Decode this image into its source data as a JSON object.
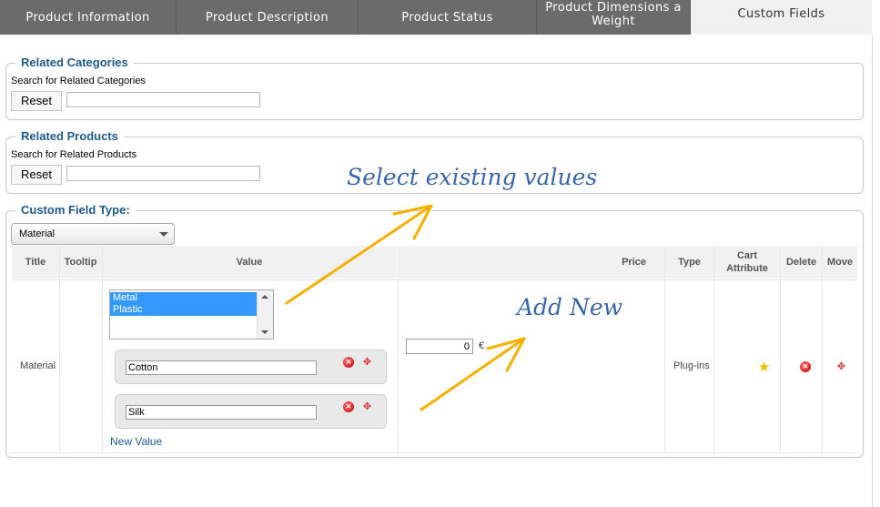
{
  "tabs": [
    {
      "label": "Product Information",
      "active": false
    },
    {
      "label": "Product Description",
      "active": false
    },
    {
      "label": "Product Status",
      "active": false
    },
    {
      "label": "Product Dimensions a Weight",
      "active": false
    },
    {
      "label": "Custom Fields",
      "active": true
    }
  ],
  "related_categories": {
    "legend": "Related Categories",
    "search_label": "Search for Related Categories",
    "reset_label": "Reset",
    "search_value": ""
  },
  "related_products": {
    "legend": "Related Products",
    "search_label": "Search for Related Products",
    "reset_label": "Reset",
    "search_value": ""
  },
  "custom_field_type": {
    "legend": "Custom Field Type:",
    "selected": "Material"
  },
  "table": {
    "headers": {
      "title": "Title",
      "tooltip": "Tooltip",
      "value": "Value",
      "price": "Price",
      "type": "Type",
      "cart_attribute": "Cart Attribute",
      "delete": "Delete",
      "move": "Move"
    },
    "row": {
      "title": "Material",
      "tooltip": "",
      "existing_values": [
        "Metal",
        "Plastic"
      ],
      "new_values": [
        "Cotton",
        "Silk"
      ],
      "new_value_link": "New Value",
      "price": "0",
      "currency": "€",
      "type": "Plug-ins"
    }
  },
  "annotations": {
    "select_existing": "Select existing values",
    "add_new": "Add New",
    "color": "#3a66a8",
    "arrow_color": "#f5b000"
  }
}
